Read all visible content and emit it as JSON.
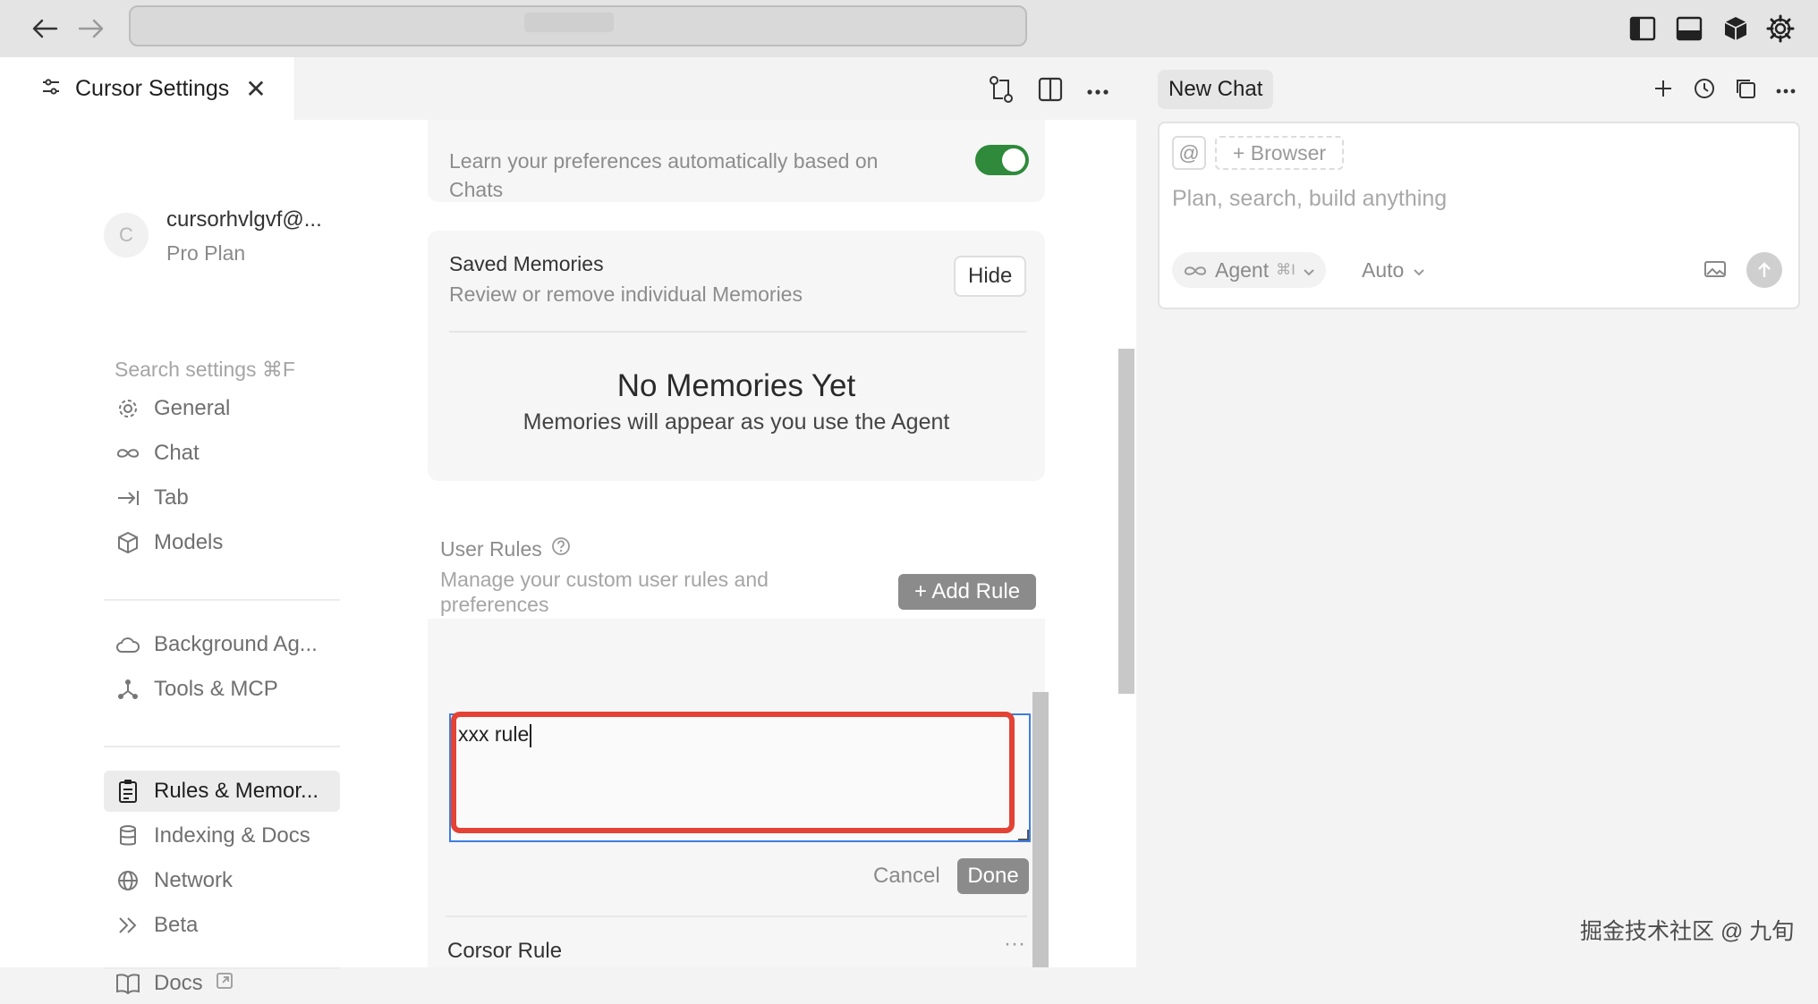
{
  "titlebar": {
    "back_icon": "arrow-left-icon",
    "forward_icon": "arrow-right-icon",
    "right_icons": [
      "sidebar-left-icon",
      "panel-bottom-icon",
      "cube-icon",
      "gear-icon"
    ]
  },
  "editor": {
    "tab_title": "Cursor Settings",
    "tab_close": "✕"
  },
  "sidebar": {
    "account_initial": "C",
    "account_email": "cursorhvlgvf@...",
    "account_plan": "Pro Plan",
    "search_placeholder": "Search settings ⌘F",
    "items": [
      {
        "label": "General",
        "icon": "gear-icon"
      },
      {
        "label": "Chat",
        "icon": "infinity-icon"
      },
      {
        "label": "Tab",
        "icon": "tab-arrow-icon"
      },
      {
        "label": "Models",
        "icon": "cube-icon"
      },
      {
        "label": "Background Ag...",
        "icon": "cloud-icon"
      },
      {
        "label": "Tools & MCP",
        "icon": "tools-icon"
      },
      {
        "label": "Rules & Memor...",
        "icon": "clipboard-icon"
      },
      {
        "label": "Indexing & Docs",
        "icon": "database-icon"
      },
      {
        "label": "Network",
        "icon": "globe-icon"
      },
      {
        "label": "Beta",
        "icon": "chevrons-right-icon"
      },
      {
        "label": "Docs",
        "icon": "book-icon"
      }
    ]
  },
  "content": {
    "memory_text_line1": "Learn your preferences automatically based on",
    "memory_text_line2": "Chats",
    "saved_title": "Saved Memories",
    "saved_subtitle": "Review or remove individual Memories",
    "hide_label": "Hide",
    "empty_title": "No Memories Yet",
    "empty_subtitle": "Memories will appear as you use the Agent",
    "rules_title": "User Rules",
    "rules_desc_line1": "Manage your custom user rules and",
    "rules_desc_line2": "preferences",
    "add_rule_label": "+ Add Rule",
    "rule_input_value": "xxx rule",
    "cancel_label": "Cancel",
    "done_label": "Done",
    "existing_rule": "Corsor Rule",
    "existing_rule_menu": "···"
  },
  "chat": {
    "tab_label": "New Chat",
    "at_label": "@",
    "browser_label": "+ Browser",
    "placeholder": "Plan, search, build anything",
    "agent_label": "Agent",
    "agent_shortcut": "⌘I",
    "model_label": "Auto"
  },
  "watermark": "掘金技术社区 @ 九旬",
  "colors": {
    "toggle_on": "#2f8a3c",
    "highlight": "#e34234",
    "focus": "#3d7de0"
  }
}
